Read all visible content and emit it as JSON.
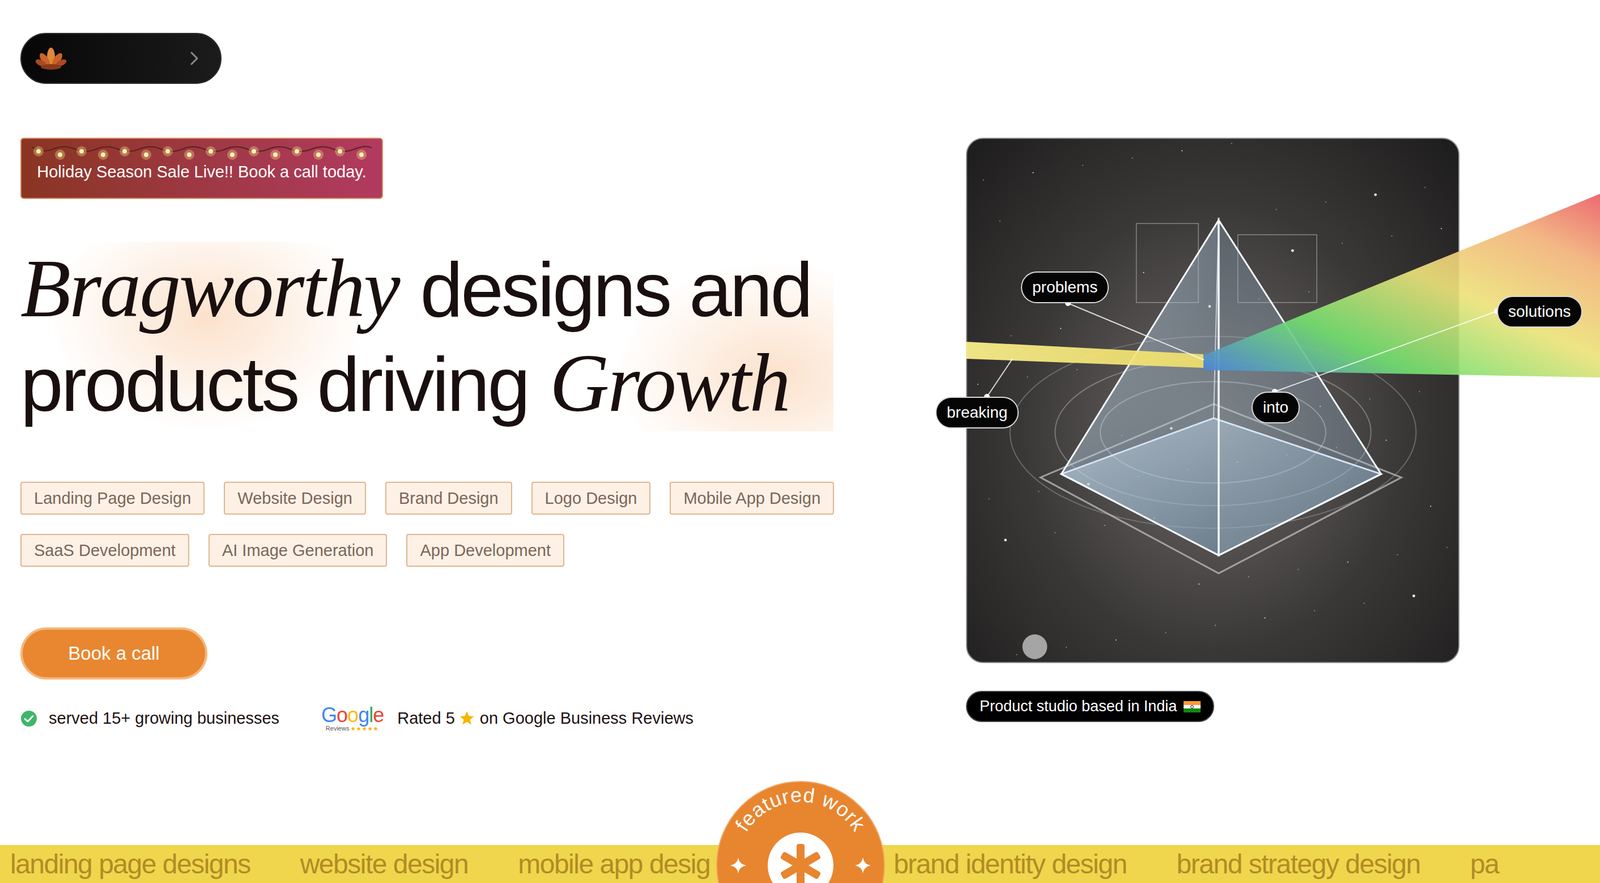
{
  "banner": {
    "text": "Holiday Season Sale Live!! Book a call today."
  },
  "headline": {
    "lines": [
      [
        {
          "text": "Bragworthy",
          "italic": true
        },
        {
          "text": "designs and",
          "italic": false
        }
      ],
      [
        {
          "text": "products driving",
          "italic": false
        },
        {
          "text": "Growth",
          "italic": true
        }
      ]
    ]
  },
  "services": [
    "Landing Page Design",
    "Website Design",
    "Brand Design",
    "Logo Design",
    "Mobile App Design",
    "SaaS Development",
    "AI Image Generation",
    "App Development"
  ],
  "cta": {
    "label": "Book a call"
  },
  "served": {
    "text": "served 15+ growing businesses"
  },
  "google": {
    "logo": "Google",
    "logo_caption": "Reviews",
    "logo_stars": 5,
    "rating": "Rated 5",
    "rating_stars": 1,
    "rating_source": "on Google Business Reviews"
  },
  "hero_image": {
    "labels": [
      "problems",
      "breaking",
      "into",
      "solutions"
    ]
  },
  "studio": {
    "text": "Product studio based in India"
  },
  "marquee": {
    "before_badge": [
      "landing page designs",
      "website design",
      "mobile app desig"
    ],
    "after_badge": [
      "brand identity design",
      "brand strategy design",
      "pa"
    ]
  },
  "badge": {
    "text": "featured work"
  }
}
